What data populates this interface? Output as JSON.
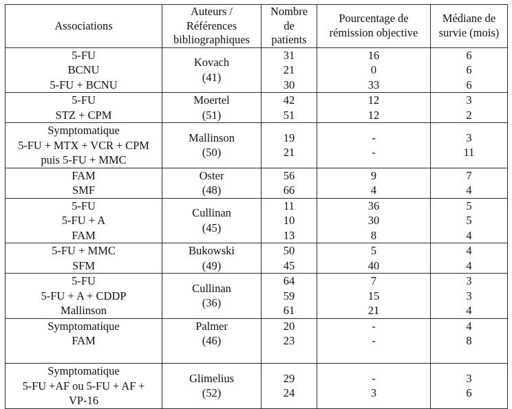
{
  "table": {
    "caption_present": false,
    "columns": [
      {
        "key": "associations",
        "header_lines": [
          "Associations"
        ]
      },
      {
        "key": "auteurs",
        "header_lines": [
          "Auteurs /",
          "Références",
          "bibliographiques"
        ]
      },
      {
        "key": "nombre",
        "header_lines": [
          "Nombre",
          "de",
          "patients"
        ]
      },
      {
        "key": "pourcentage",
        "header_lines": [
          "Pourcentage de",
          "rémission objective"
        ]
      },
      {
        "key": "mediane",
        "header_lines": [
          "Médiane de",
          "survie (mois)"
        ]
      }
    ],
    "groups": [
      {
        "associations": [
          "5-FU",
          "BCNU",
          "5-FU + BCNU"
        ],
        "auteurs": [
          "Kovach",
          "(41)"
        ],
        "nombre": [
          "31",
          "21",
          "30"
        ],
        "pourcentage": [
          "16",
          "0",
          "33"
        ],
        "mediane": [
          "6",
          "6",
          "6"
        ]
      },
      {
        "associations": [
          "5-FU",
          "STZ + CPM"
        ],
        "auteurs": [
          "Moertel",
          "(51)"
        ],
        "nombre": [
          "42",
          "51"
        ],
        "pourcentage": [
          "12",
          "12"
        ],
        "mediane": [
          "3",
          "2"
        ]
      },
      {
        "associations": [
          "Symptomatique",
          "5-FU + MTX + VCR + CPM",
          "puis 5-FU + MMC"
        ],
        "auteurs": [
          "Mallinson",
          "(50)"
        ],
        "nombre": [
          "19",
          "21"
        ],
        "pourcentage": [
          "-",
          "-"
        ],
        "mediane": [
          "3",
          "11"
        ]
      },
      {
        "associations": [
          "FAM",
          "SMF"
        ],
        "auteurs": [
          "Oster",
          "(48)"
        ],
        "nombre": [
          "56",
          "66"
        ],
        "pourcentage": [
          "9",
          "4"
        ],
        "mediane": [
          "7",
          "4"
        ]
      },
      {
        "associations": [
          "5-FU",
          "5-FU + A",
          "FAM"
        ],
        "auteurs": [
          "Cullinan",
          "(45)"
        ],
        "nombre": [
          "11",
          "10",
          "13"
        ],
        "pourcentage": [
          "36",
          "30",
          "8"
        ],
        "mediane": [
          "5",
          "5",
          "4"
        ]
      },
      {
        "associations": [
          "5-FU + MMC",
          "SFM"
        ],
        "auteurs": [
          "Bukowski",
          "(49)"
        ],
        "nombre": [
          "50",
          "45"
        ],
        "pourcentage": [
          "5",
          "40"
        ],
        "mediane": [
          "4",
          "4"
        ]
      },
      {
        "associations": [
          "5-FU",
          "5-FU + A + CDDP",
          "Mallinson"
        ],
        "auteurs": [
          "Cullinan",
          "(36)"
        ],
        "nombre": [
          "64",
          "59",
          "61"
        ],
        "pourcentage": [
          "7",
          "15",
          "21"
        ],
        "mediane": [
          "3",
          "3",
          "4"
        ]
      },
      {
        "associations": [
          "Symptomatique",
          "FAM",
          ""
        ],
        "auteurs": [
          "Palmer",
          "(46)",
          ""
        ],
        "nombre": [
          "20",
          "23",
          ""
        ],
        "pourcentage": [
          "-",
          "-",
          ""
        ],
        "mediane": [
          "4",
          "8",
          ""
        ]
      },
      {
        "associations": [
          "Symptomatique",
          "5-FU +AF ou 5-FU + AF +",
          "VP-16"
        ],
        "auteurs": [
          "Glimelius",
          "(52)"
        ],
        "nombre": [
          "29",
          "24"
        ],
        "pourcentage": [
          "-",
          "3"
        ],
        "mediane": [
          "3",
          "6"
        ]
      }
    ]
  }
}
